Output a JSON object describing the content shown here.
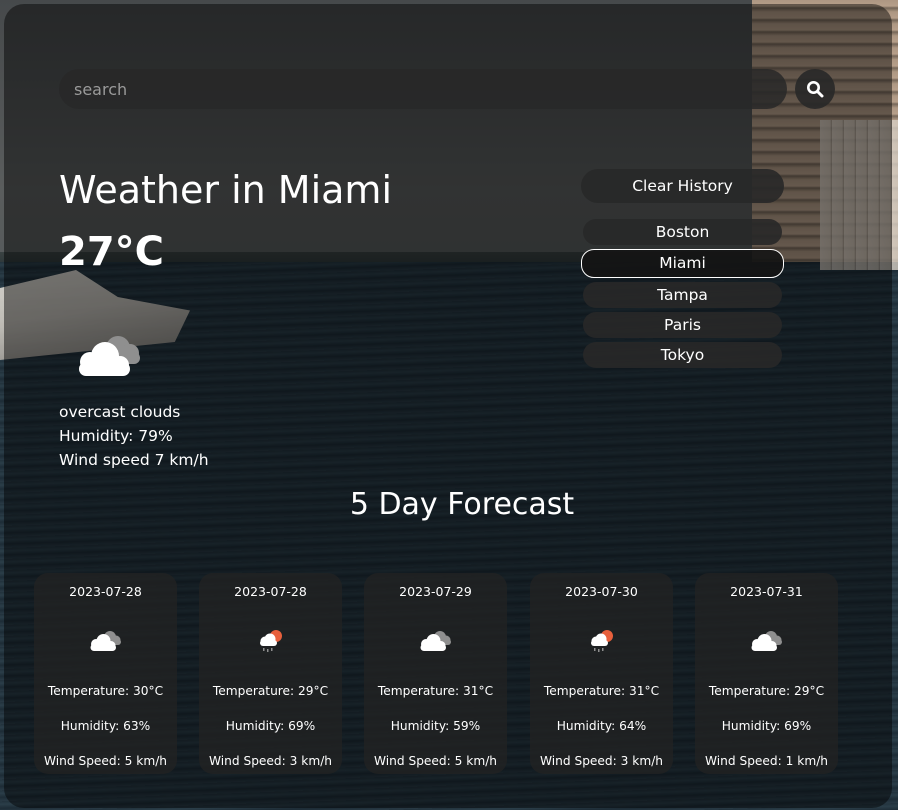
{
  "search": {
    "placeholder": "search",
    "value": ""
  },
  "current": {
    "title": "Weather in Miami",
    "temperature": "27°C",
    "icon": "overcast-clouds-icon",
    "description": "overcast clouds",
    "humidity": "Humidity: 79%",
    "wind": "Wind speed 7 km/h"
  },
  "history": {
    "clear_label": "Clear History",
    "items": [
      {
        "label": "Boston",
        "active": false
      },
      {
        "label": "Miami",
        "active": true
      },
      {
        "label": "Tampa",
        "active": false
      },
      {
        "label": "Paris",
        "active": false
      },
      {
        "label": "Tokyo",
        "active": false
      }
    ]
  },
  "forecast": {
    "title": "5 Day Forecast",
    "days": [
      {
        "date": "2023-07-28",
        "icon": "overcast-clouds-icon",
        "temperature": "Temperature: 30°C",
        "humidity": "Humidity: 63%",
        "wind": "Wind Speed: 5 km/h"
      },
      {
        "date": "2023-07-28",
        "icon": "rain-sun-icon",
        "temperature": "Temperature: 29°C",
        "humidity": "Humidity: 69%",
        "wind": "Wind Speed: 3 km/h"
      },
      {
        "date": "2023-07-29",
        "icon": "overcast-clouds-icon",
        "temperature": "Temperature: 31°C",
        "humidity": "Humidity: 59%",
        "wind": "Wind Speed: 5 km/h"
      },
      {
        "date": "2023-07-30",
        "icon": "rain-sun-icon",
        "temperature": "Temperature: 31°C",
        "humidity": "Humidity: 64%",
        "wind": "Wind Speed: 3 km/h"
      },
      {
        "date": "2023-07-31",
        "icon": "overcast-clouds-icon",
        "temperature": "Temperature: 29°C",
        "humidity": "Humidity: 69%",
        "wind": "Wind Speed: 1 km/h"
      }
    ]
  },
  "colors": {
    "panel": "#000000",
    "card": "#232323",
    "sun": "#e8603c"
  }
}
